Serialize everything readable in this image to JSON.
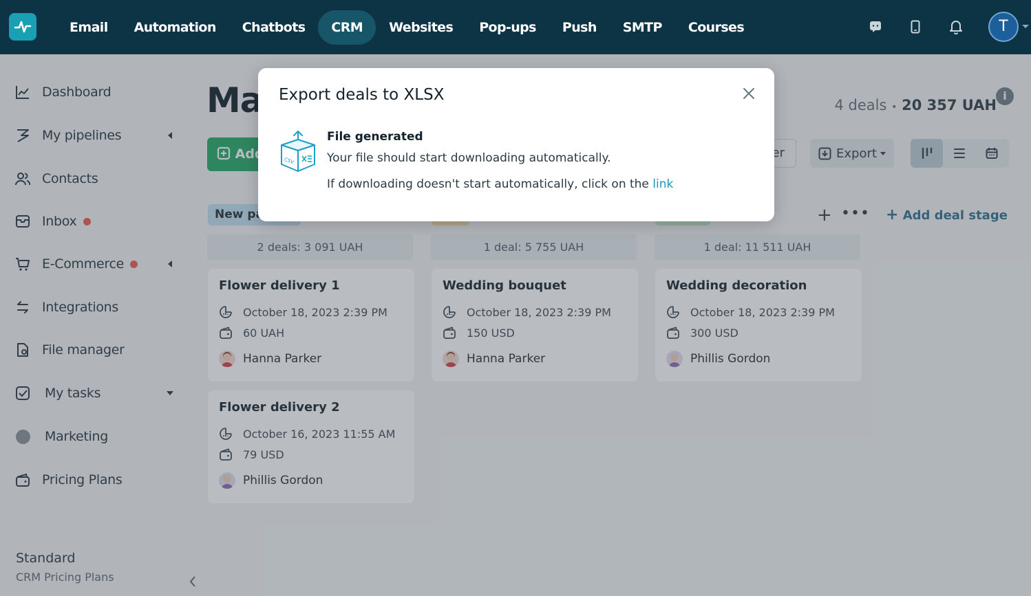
{
  "nav": {
    "items": [
      {
        "label": "Email"
      },
      {
        "label": "Automation"
      },
      {
        "label": "Chatbots"
      },
      {
        "label": "CRM",
        "active": true
      },
      {
        "label": "Websites"
      },
      {
        "label": "Pop-ups"
      },
      {
        "label": "Push"
      },
      {
        "label": "SMTP"
      },
      {
        "label": "Courses"
      }
    ],
    "avatar_letter": "T"
  },
  "sidebar": {
    "items": [
      {
        "label": "Dashboard"
      },
      {
        "label": "My pipelines"
      },
      {
        "label": "Contacts"
      },
      {
        "label": "Inbox"
      },
      {
        "label": "E-Commerce"
      },
      {
        "label": "Integrations"
      },
      {
        "label": "File manager"
      },
      {
        "label": "My tasks"
      },
      {
        "label": "Marketing"
      },
      {
        "label": "Pricing Plans"
      }
    ],
    "plan_name": "Standard",
    "plan_sub": "CRM Pricing Plans"
  },
  "main": {
    "title_visible": "Ma",
    "deals_count": "4 deals",
    "deals_total": "20 357 UAH",
    "add_label": "Add",
    "filter_label": "er",
    "export_label": "Export",
    "first_stage_label": "New pa",
    "add_stage_label": "Add deal stage",
    "columns": [
      {
        "summary": "2 deals: 3 091 UAH",
        "cards": [
          {
            "title": "Flower delivery 1",
            "date": "October 18, 2023 2:39 PM",
            "amount": "60 UAH",
            "person": "Hanna Parker"
          },
          {
            "title": "Flower delivery 2",
            "date": "October 16, 2023 11:55 AM",
            "amount": "79 USD",
            "person": "Phillis Gordon"
          }
        ]
      },
      {
        "summary": "1 deal: 5 755 UAH",
        "cards": [
          {
            "title": "Wedding bouquet",
            "date": "October 18, 2023 2:39 PM",
            "amount": "150 USD",
            "person": "Hanna Parker"
          }
        ]
      },
      {
        "summary": "1 deal: 11 511 UAH",
        "cards": [
          {
            "title": "Wedding decoration",
            "date": "October 18, 2023 2:39 PM",
            "amount": "300 USD",
            "person": "Phillis Gordon"
          }
        ]
      }
    ]
  },
  "modal": {
    "title": "Export deals to XLSX",
    "heading": "File generated",
    "line1": "Your file should start downloading automatically.",
    "line2_prefix": "If downloading doesn't start automatically, click on the ",
    "link_label": "link"
  },
  "colors": {
    "topbar": "#0d3445",
    "accent": "#1aa0b4",
    "add_button": "#1fa866",
    "link": "#1896b6",
    "notify_dot": "#e8574b"
  }
}
